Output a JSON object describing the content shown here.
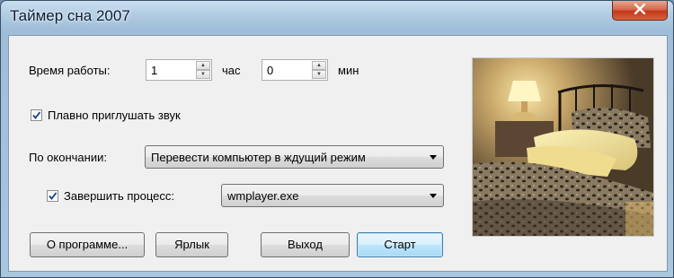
{
  "window": {
    "title": "Таймер сна 2007"
  },
  "timer": {
    "label": "Время работы:",
    "hours_value": "1",
    "hours_unit": "час",
    "minutes_value": "0",
    "minutes_unit": "мин"
  },
  "fade": {
    "checked": true,
    "label": "Плавно приглушать звук"
  },
  "on_finish": {
    "label": "По окончании:",
    "selected": "Перевести компьютер в ждущий режим"
  },
  "kill_process": {
    "checked": true,
    "label": "Завершить процесс:",
    "selected": "wmplayer.exe"
  },
  "buttons": {
    "about": "О программе...",
    "shortcut": "Ярлык",
    "exit": "Выход",
    "start": "Старт"
  },
  "colors": {
    "accent": "#3c7fb1",
    "close": "#c4371a"
  }
}
